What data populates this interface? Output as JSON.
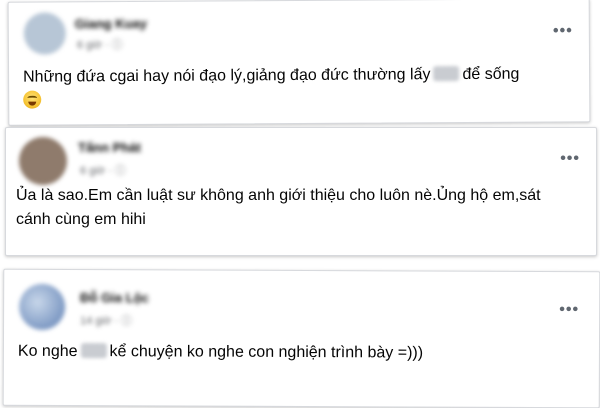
{
  "comments": [
    {
      "author": "Giang Kuay",
      "time": "6 giờ · ⓘ",
      "menu": "•••",
      "text_before": "Những đứa cgai hay nói đạo lý,giảng đạo đức thường lấy",
      "text_after": "để sống",
      "emoji": "face-with-spiral-eyes-emoji",
      "avatar_color": "#b7c6d6"
    },
    {
      "author": "Tấnn Phát",
      "time": "6 giờ · ⓘ",
      "menu": "•••",
      "text": "Ủa là sao.Em cần luật sư không anh giới thiệu cho luôn nè.Ủng hộ em,sát cánh cùng em hihi",
      "avatar_color": "#8f7b6c"
    },
    {
      "author": "Đỗ Gia Lộc",
      "time": "14 giờ · ⓘ",
      "menu": "•••",
      "text_before": "Ko nghe",
      "text_after": "kể chuyện ko nghe con nghiện trình bày =)))",
      "avatar_color": "#5e7fb3"
    }
  ]
}
